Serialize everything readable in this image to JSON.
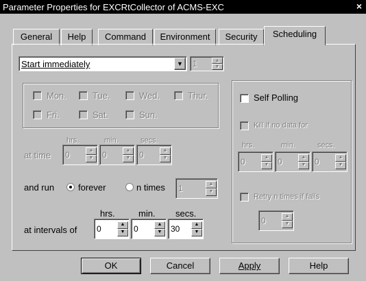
{
  "window": {
    "title": "Parameter Properties for EXCRtCollector of ACMS-EXC",
    "close_glyph": "×"
  },
  "tabs": [
    {
      "label": "General"
    },
    {
      "label": "Help"
    },
    {
      "label": "Command"
    },
    {
      "label": "Environment"
    },
    {
      "label": "Security"
    },
    {
      "label": "Scheduling",
      "active": true
    }
  ],
  "schedule": {
    "start_mode": "Start immediately",
    "start_count": "1",
    "days": [
      "Mon.",
      "Tue.",
      "Wed.",
      "Thur.",
      "Fri.",
      "Sat.",
      "Sun."
    ],
    "at_time": {
      "label": "at time",
      "hrs_label": "hrs.",
      "min_label": "min.",
      "secs_label": "secs.",
      "hrs": "0",
      "min": "0",
      "secs": "0"
    },
    "run": {
      "label": "and run",
      "forever_label": "forever",
      "ntimes_label": "n times",
      "ntimes_value": "1",
      "selected": "forever"
    },
    "intervals": {
      "label": "at intervals of",
      "hrs_label": "hrs.",
      "min_label": "min.",
      "secs_label": "secs.",
      "hrs": "0",
      "min": "0",
      "secs": "30"
    }
  },
  "polling": {
    "self_polling_label": "Self Polling",
    "kill_label": "Kill if no data for",
    "kill": {
      "hrs_label": "hrs.",
      "min_label": "min.",
      "secs_label": "secs.",
      "hrs": "0",
      "min": "0",
      "secs": "0"
    },
    "retry_label": "Retry n times if fails",
    "retry_value": "0"
  },
  "buttons": {
    "ok": "OK",
    "cancel": "Cancel",
    "apply": "Apply",
    "help": "Help"
  }
}
